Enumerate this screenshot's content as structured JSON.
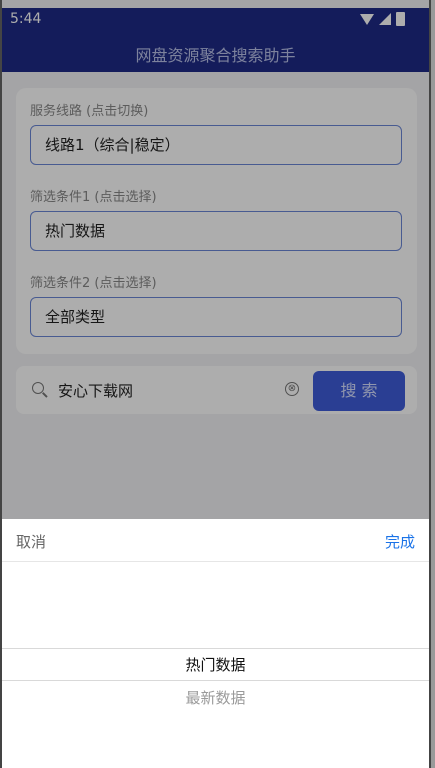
{
  "status": {
    "time": "5:44"
  },
  "app": {
    "title": "网盘资源聚合搜索助手"
  },
  "form": {
    "route_label": "服务线路 (点击切换)",
    "route_value": "线路1（综合|稳定）",
    "filter1_label": "筛选条件1 (点击选择)",
    "filter1_value": "热门数据",
    "filter2_label": "筛选条件2 (点击选择)",
    "filter2_value": "全部类型"
  },
  "search": {
    "input_value": "安心下载网",
    "clear_icon": "⊗",
    "button_label": "搜 索"
  },
  "picker": {
    "cancel_label": "取消",
    "done_label": "完成",
    "selected_option": "热门数据",
    "next_option": "最新数据"
  }
}
